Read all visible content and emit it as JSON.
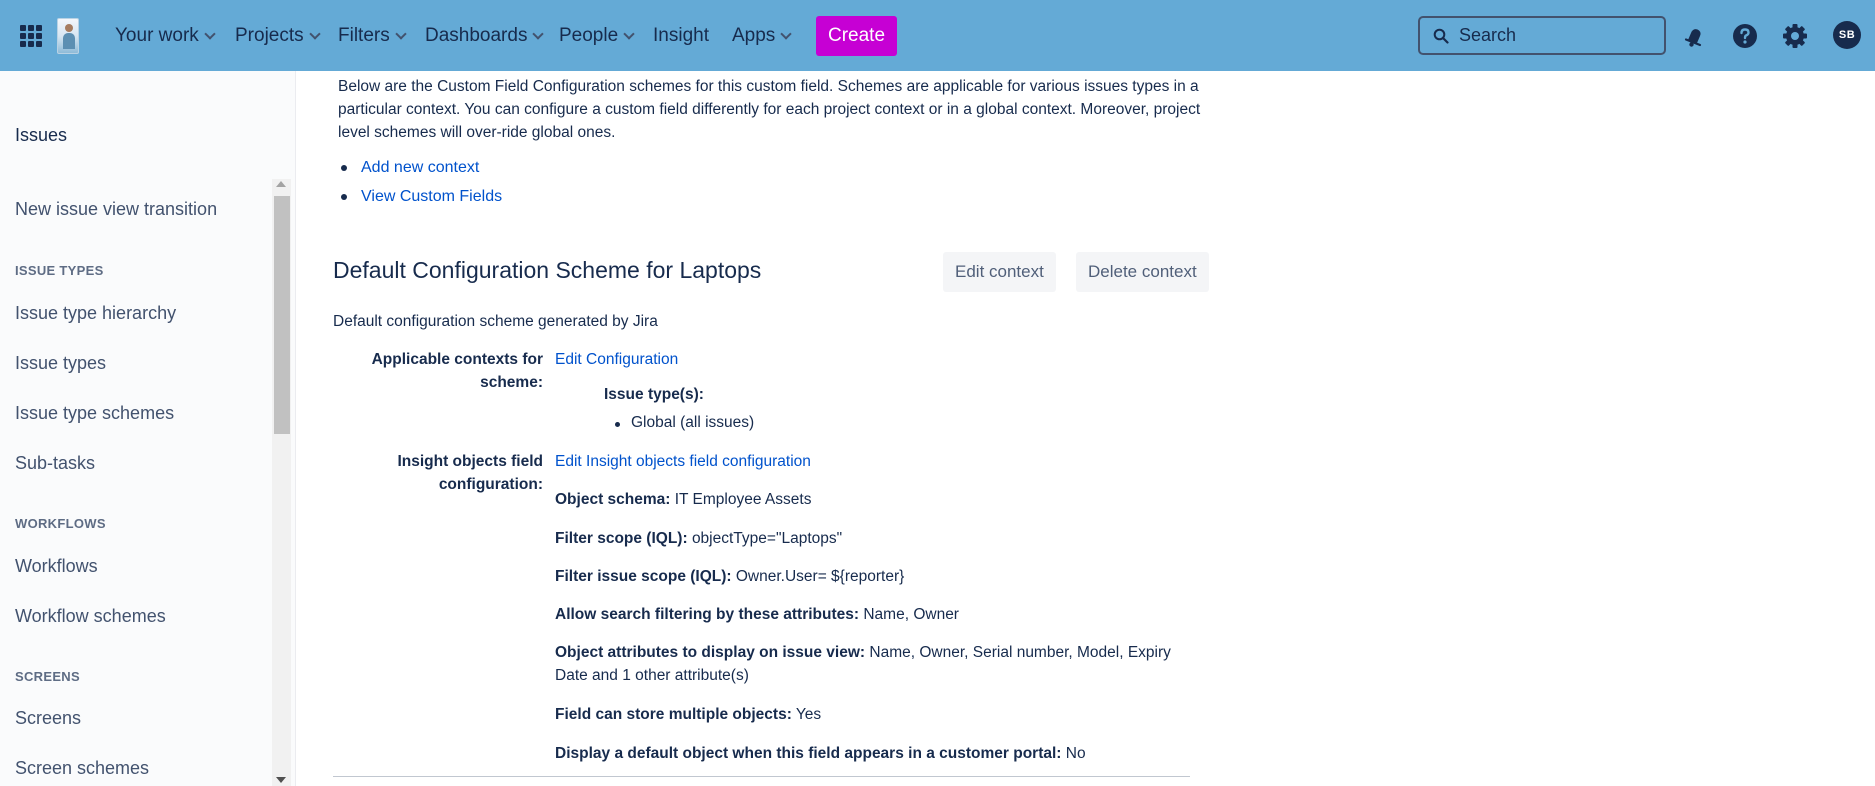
{
  "topnav": {
    "items": [
      {
        "label": "Your work",
        "dropdown": true
      },
      {
        "label": "Projects",
        "dropdown": true
      },
      {
        "label": "Filters",
        "dropdown": true
      },
      {
        "label": "Dashboards",
        "dropdown": true
      },
      {
        "label": "People",
        "dropdown": true
      },
      {
        "label": "Insight",
        "dropdown": false
      },
      {
        "label": "Apps",
        "dropdown": true
      }
    ],
    "create_label": "Create",
    "search_placeholder": "Search",
    "avatar_initials": "SB",
    "bar_color": "#64aad6",
    "create_color": "#c600d4"
  },
  "sidebar": {
    "title": "Issues",
    "link_new_issue_view": "New issue view transition",
    "section_issue_types": "ISSUE TYPES",
    "link_issue_type_hierarchy": "Issue type hierarchy",
    "link_issue_types": "Issue types",
    "link_issue_type_schemes": "Issue type schemes",
    "link_sub_tasks": "Sub-tasks",
    "section_workflows": "WORKFLOWS",
    "link_workflows": "Workflows",
    "link_workflow_schemes": "Workflow schemes",
    "section_screens": "SCREENS",
    "link_screens": "Screens",
    "link_screen_schemes": "Screen schemes"
  },
  "main": {
    "intro": "Below are the Custom Field Configuration schemes for this custom field. Schemes are applicable for various issues types in a particular context. You can configure a custom field differently for each project context or in a global context. Moreover, project level schemes will over-ride global ones.",
    "links": {
      "add_context": "Add new context",
      "view_custom_fields": "View Custom Fields"
    },
    "scheme": {
      "title": "Default Configuration Scheme for Laptops",
      "edit_context": "Edit context",
      "delete_context": "Delete context",
      "description": "Default configuration scheme generated by Jira",
      "applicable_label": "Applicable contexts for scheme:",
      "edit_configuration": "Edit Configuration",
      "issue_types_head": "Issue type(s):",
      "issue_type_global": "Global (all issues)",
      "insight_label": "Insight objects field configuration:",
      "edit_insight": "Edit Insight objects field configuration",
      "object_schema_label": "Object schema:",
      "object_schema_value": "IT Employee Assets",
      "filter_scope_label": "Filter scope (IQL):",
      "filter_scope_value": "objectType=\"Laptops\"",
      "filter_issue_scope_label": "Filter issue scope (IQL):",
      "filter_issue_scope_value": "Owner.User= ${reporter}",
      "search_filter_label": "Allow search filtering by these attributes:",
      "search_filter_value": "Name, Owner",
      "display_attrs_label": "Object attributes to display on issue view:",
      "display_attrs_value": "Name, Owner, Serial number, Model, Expiry Date and 1 other attribute(s)",
      "multiple_label": "Field can store multiple objects:",
      "multiple_value": "Yes",
      "default_object_label": "Display a default object when this field appears in a customer portal:",
      "default_object_value": "No"
    }
  }
}
